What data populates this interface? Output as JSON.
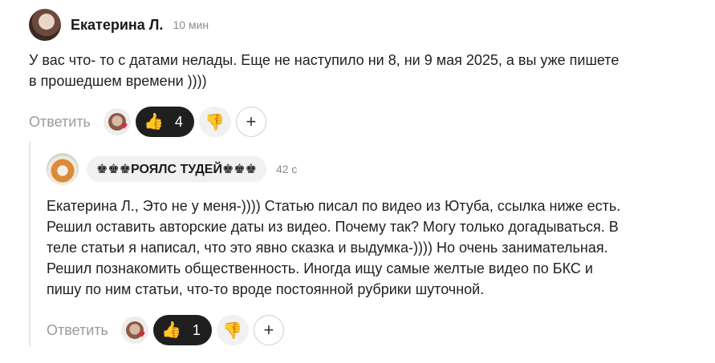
{
  "comment": {
    "author": "Екатерина Л.",
    "time": "10 мин",
    "text_lines": [
      "У вас что- то с датами нелады. Еще не наступило ни 8, ни 9 мая 2025, а вы уже пишете",
      "в прошедшем времени ))))"
    ],
    "reply_label": "Ответить",
    "like_emoji": "👍",
    "like_count": "4",
    "dislike_emoji": "👎",
    "add_label": "+"
  },
  "reply": {
    "author": "♚♚♚РОЯЛС ТУДЕЙ♚♚♚",
    "time": "42 с",
    "text_lines": [
      "Екатерина Л., Это не у меня-)))) Статью писал по видео из Ютуба, ссылка ниже есть.",
      "Решил оставить авторские даты из видео. Почему так? Могу только догадываться. В",
      "теле статьи я написал, что это явно сказка и выдумка-)))) Но очень занимательная.",
      "Решил познакомить общественность. Иногда ищу самые желтые видео по БКС и",
      "пишу по ним статьи, что-то вроде постоянной рубрики шуточной."
    ],
    "reply_label": "Ответить",
    "like_emoji": "👍",
    "like_count": "1",
    "dislike_emoji": "👎",
    "add_label": "+"
  },
  "reaction_heart": "♥"
}
